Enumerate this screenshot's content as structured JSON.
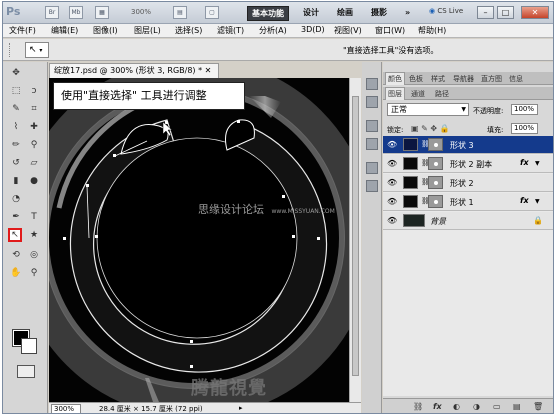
{
  "titlebar": {
    "app_logo": "Ps",
    "icons": [
      "Br",
      "Mb"
    ],
    "zoom": "300%",
    "workspaces": [
      "基本功能",
      "设计",
      "绘画",
      "摄影",
      "»"
    ],
    "cs_live": "CS Live",
    "win_buttons": [
      "–",
      "□",
      "✕"
    ]
  },
  "menubar": {
    "items": [
      "文件(F)",
      "编辑(E)",
      "图像(I)",
      "图层(L)",
      "选择(S)",
      "滤镜(T)",
      "分析(A)",
      "3D(D)",
      "视图(V)",
      "窗口(W)",
      "帮助(H)"
    ]
  },
  "options_bar": {
    "tool_icon": "↖",
    "hint": "\"直接选择工具\"没有选项。"
  },
  "document": {
    "tab_title": "绽放17.psd @ 300% (形状 3, RGB/8) * ✕",
    "callout": "使用\"直接选择\" 工具进行调整",
    "watermark1": "思缘设计论坛",
    "watermark1_url": "www.MISSYUAN.COM",
    "watermark2": "腾龍視覺WWW.TLVI.NET",
    "status_zoom": "300%",
    "status_info": "28.4 厘米 × 15.7 厘米 (72 ppi)"
  },
  "panels": {
    "top_tabs": [
      "颜色",
      "色板",
      "样式",
      "导航器",
      "直方图",
      "信息"
    ],
    "layer_tabs": [
      "图层",
      "通道",
      "路径"
    ],
    "blend_mode": "正常",
    "opacity_label": "不透明度:",
    "opacity_value": "100%",
    "lock_label": "锁定:",
    "fill_label": "填充:",
    "fill_value": "100%",
    "layers": [
      {
        "name": "形状 3",
        "selected": true,
        "fx": false
      },
      {
        "name": "形状 2 副本",
        "selected": false,
        "fx": true
      },
      {
        "name": "形状 2",
        "selected": false,
        "fx": false
      },
      {
        "name": "形状 1",
        "selected": false,
        "fx": true
      },
      {
        "name": "背景",
        "selected": false,
        "fx": false,
        "background": true
      }
    ],
    "fx_label": "fx",
    "bottom_icons": [
      "⛓",
      "fx",
      "◐",
      "◑",
      "▭",
      "▤",
      "🗑"
    ]
  }
}
